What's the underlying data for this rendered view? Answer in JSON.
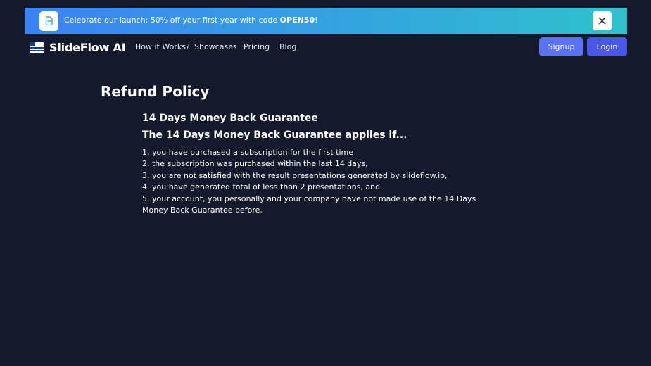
{
  "banner": {
    "text_before": "Celebrate our launch: 50% off your first year with code ",
    "code": "OPEN50",
    "text_after": "!",
    "icon": "document-icon",
    "close_icon": "close-icon"
  },
  "header": {
    "logo_text": "SlideFlow AI",
    "logo_icon": "flag-icon",
    "nav": [
      {
        "label": "How it Works?"
      },
      {
        "label": "Showcases"
      },
      {
        "label": "Pricing"
      },
      {
        "label": "Blog"
      }
    ],
    "signup_label": "Signup",
    "login_label": "Login"
  },
  "content": {
    "title": "Refund Policy",
    "heading": "14 Days Money Back Guarantee",
    "subheading": "The 14 Days Money Back Guarantee applies if...",
    "conditions": [
      "1. you have purchased a subscription for the first time",
      "2. the subscription was purchased within the last 14 days,",
      "3. you are not satisfied with the result presentations generated by slideflow.io,",
      "4. you have generated total of less than 2 presentations, and",
      "5. your account, you personally and your company have not made use of the 14 Days Money Back Guarantee before."
    ]
  },
  "colors": {
    "background": "#141a2b",
    "banner_start": "#3b82f6",
    "banner_end": "#2fc1cc",
    "signup": "#5b72f2",
    "login": "#4a56e8"
  }
}
